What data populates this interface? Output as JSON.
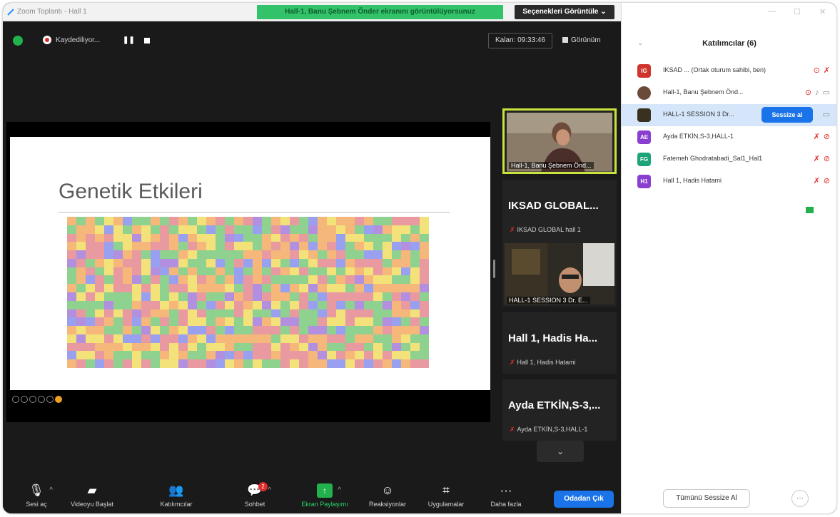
{
  "window": {
    "title": "Zoom Toplantı - Hall 1",
    "share_banner": "Hall-1, Banu Şebnem Önder ekranını görüntülüyorsunuz",
    "view_options": "Seçenekleri Görüntüle ⌄"
  },
  "topbar": {
    "recording_label": "Kaydediliyor...",
    "timer": "Kalan: 09:33:46",
    "view_label": "Görünüm"
  },
  "slide": {
    "title": "Genetik Etkileri"
  },
  "thumbnails": [
    {
      "name": "Hall-1, Banu Şebnem Önd..."
    },
    {
      "bigname": "IKSAD GLOBAL...",
      "sub": "IKSAD GLOBAL hall 1"
    },
    {
      "name": "HALL-1 SESSION 3 Dr. E..."
    },
    {
      "bigname": "Hall 1, Hadis Ha...",
      "sub": "Hall 1, Hadis Hatami"
    },
    {
      "bigname": "Ayda ETKİN,S-3,...",
      "sub": "Ayda ETKİN,S-3,HALL-1"
    }
  ],
  "toolbar": {
    "items": [
      {
        "label": "Sesi aç",
        "icon": "mic-muted-icon"
      },
      {
        "label": "Videoyu Başlat",
        "icon": "video-off-icon"
      },
      {
        "label": "Katılımcılar",
        "icon": "participants-icon",
        "count": "6"
      },
      {
        "label": "Sohbet",
        "icon": "chat-icon",
        "badge": "2"
      },
      {
        "label": "Ekran Paylaşımı",
        "icon": "share-screen-icon"
      },
      {
        "label": "Reaksiyonlar",
        "icon": "reactions-icon"
      },
      {
        "label": "Uygulamalar",
        "icon": "apps-icon"
      },
      {
        "label": "Daha fazla",
        "icon": "more-icon"
      }
    ],
    "leave": "Odadan Çık"
  },
  "panel": {
    "title": "Katılımcılar (6)",
    "participants": [
      {
        "initials": "IG",
        "color": "#d0342c",
        "name": "IKSAD ...   (Ortak oturum sahibi, ben)"
      },
      {
        "initials": "",
        "color": "#6b4a3a",
        "name": "Hall-1, Banu Şebnem Önd..."
      },
      {
        "initials": "",
        "color": "#3a3020",
        "name": "HALL-1 SESSION 3  Dr..."
      },
      {
        "initials": "AE",
        "color": "#8a3fd1",
        "name": "Ayda ETKİN,S-3,HALL-1"
      },
      {
        "initials": "FG",
        "color": "#1fa37a",
        "name": "Fatemeh Ghodratabadi_Sal1_Hal1"
      },
      {
        "initials": "H1",
        "color": "#8a3fd1",
        "name": "Hall 1, Hadis Hatami"
      }
    ],
    "mute_button": "Sessize al",
    "mute_all": "Tümünü Sessize Al",
    "more": "···"
  },
  "colors": {
    "accent_blue": "#1a73e8",
    "share_green": "#22b14c",
    "active_speaker": "#c8e33b"
  }
}
